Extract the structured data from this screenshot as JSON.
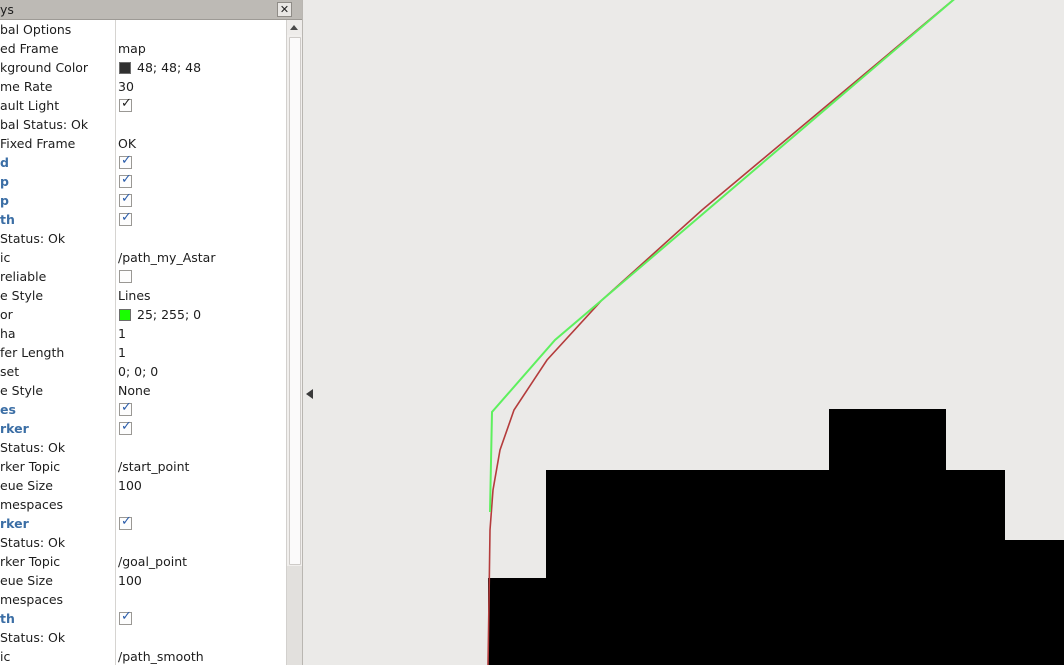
{
  "panel": {
    "title": "ys",
    "close_label": "✕",
    "close_icon": "close-icon"
  },
  "scrollbar": {
    "up_arrow_icon": "scroll-up-arrow-icon"
  },
  "collapse_handle": {
    "icon": "chevron-left-icon"
  },
  "cursor": {
    "icon": "pointer-move-cursor"
  },
  "properties": [
    {
      "name": "bal Options",
      "kind": "group",
      "value": ""
    },
    {
      "name": "ed Frame",
      "kind": "text",
      "value": "map"
    },
    {
      "name": "kground Color",
      "kind": "color",
      "value": "48; 48; 48",
      "swatch": "#303030"
    },
    {
      "name": "me Rate",
      "kind": "text",
      "value": "30"
    },
    {
      "name": "ault Light",
      "kind": "checkbox",
      "value": "checked",
      "mark": "✓",
      "dark": true
    },
    {
      "name": "bal Status: Ok",
      "kind": "status",
      "value": ""
    },
    {
      "name": "Fixed Frame",
      "kind": "text",
      "value": "OK"
    },
    {
      "name": "d",
      "kind": "checkbox",
      "display": true,
      "value": "checked",
      "mark": "✓"
    },
    {
      "name": "p",
      "kind": "checkbox",
      "display": true,
      "value": "checked",
      "mark": "✓"
    },
    {
      "name": "p",
      "kind": "checkbox",
      "display": true,
      "value": "checked",
      "mark": "✓"
    },
    {
      "name": "th",
      "kind": "checkbox",
      "display": true,
      "value": "checked",
      "mark": "✓"
    },
    {
      "name": "Status: Ok",
      "kind": "status",
      "value": ""
    },
    {
      "name": "ic",
      "kind": "text",
      "value": "/path_my_Astar"
    },
    {
      "name": "reliable",
      "kind": "checkbox",
      "value": "unchecked",
      "mark": ""
    },
    {
      "name": "e Style",
      "kind": "text",
      "value": "Lines"
    },
    {
      "name": "or",
      "kind": "color",
      "value": "25; 255; 0",
      "swatch": "#19ff00"
    },
    {
      "name": "ha",
      "kind": "text",
      "value": "1"
    },
    {
      "name": "fer Length",
      "kind": "text",
      "value": "1"
    },
    {
      "name": "set",
      "kind": "text",
      "value": "0; 0; 0"
    },
    {
      "name": "e Style",
      "kind": "text",
      "value": "None"
    },
    {
      "name": "es",
      "kind": "checkbox",
      "display": true,
      "value": "checked",
      "mark": "✓"
    },
    {
      "name": "rker",
      "kind": "checkbox",
      "display": true,
      "value": "checked",
      "mark": "✓"
    },
    {
      "name": "Status: Ok",
      "kind": "status",
      "value": ""
    },
    {
      "name": "rker Topic",
      "kind": "text",
      "value": "/start_point"
    },
    {
      "name": "eue Size",
      "kind": "text",
      "value": "100"
    },
    {
      "name": "mespaces",
      "kind": "text",
      "value": ""
    },
    {
      "name": "rker",
      "kind": "checkbox",
      "display": true,
      "value": "checked",
      "mark": "✓"
    },
    {
      "name": "Status: Ok",
      "kind": "status",
      "value": ""
    },
    {
      "name": "rker Topic",
      "kind": "text",
      "value": "/goal_point"
    },
    {
      "name": "eue Size",
      "kind": "text",
      "value": "100"
    },
    {
      "name": "mespaces",
      "kind": "text",
      "value": ""
    },
    {
      "name": "th",
      "kind": "checkbox",
      "display": true,
      "value": "checked",
      "mark": "✓"
    },
    {
      "name": "Status: Ok",
      "kind": "status",
      "value": ""
    },
    {
      "name": "ic",
      "kind": "text",
      "value": "/path_smooth"
    }
  ],
  "viewport": {
    "background_color": "#ebeae8",
    "astar_path_color": "#5ef05e",
    "smooth_path_color": "#b43c3c",
    "obstacle_color": "#000000"
  }
}
